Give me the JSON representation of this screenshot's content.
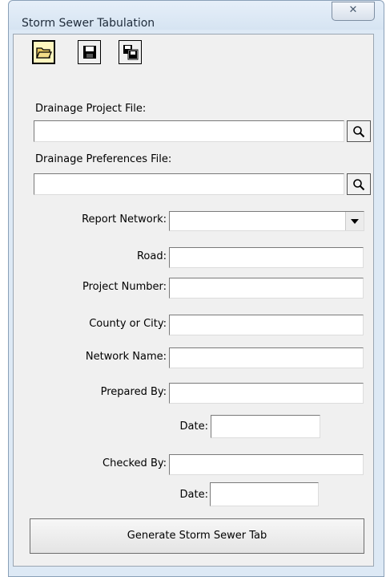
{
  "window": {
    "title": "Storm Sewer Tabulation",
    "close_glyph": "✕"
  },
  "toolbar": {
    "icons": [
      "open-folder-icon",
      "save-icon",
      "save-as-icon"
    ]
  },
  "project_file": {
    "label": "Drainage Project File:",
    "value": ""
  },
  "preferences_file": {
    "label": "Drainage Preferences File:",
    "value": ""
  },
  "form": {
    "report_network": {
      "label": "Report Network:",
      "value": ""
    },
    "road": {
      "label": "Road:",
      "value": ""
    },
    "project_number": {
      "label": "Project Number:",
      "value": ""
    },
    "county_or_city": {
      "label": "County or City:",
      "value": ""
    },
    "network_name": {
      "label": "Network Name:",
      "value": ""
    },
    "prepared_by": {
      "label": "Prepared By:",
      "value": ""
    },
    "prepared_date": {
      "label": "Date:",
      "value": ""
    },
    "checked_by": {
      "label": "Checked By:",
      "value": ""
    },
    "checked_date": {
      "label": "Date:",
      "value": ""
    }
  },
  "generate_button": {
    "label": "Generate Storm Sewer Tab"
  },
  "colors": {
    "window_frame": "#dde9f5",
    "client_bg": "#f0f0f0",
    "active_button_bg": "#fff6bf"
  }
}
